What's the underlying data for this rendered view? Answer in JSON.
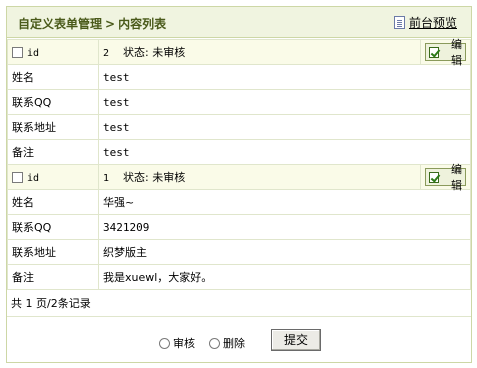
{
  "breadcrumb": {
    "root": "自定义表单管理",
    "separator": ">",
    "current": "内容列表"
  },
  "preview_link": "前台预览",
  "records": [
    {
      "id_label": "id",
      "id_value": "2",
      "status": "状态: 未审核",
      "edit_label": "编辑",
      "fields": [
        {
          "label": "姓名",
          "value": "test"
        },
        {
          "label": "联系QQ",
          "value": "test"
        },
        {
          "label": "联系地址",
          "value": "test"
        },
        {
          "label": "备注",
          "value": "test"
        }
      ]
    },
    {
      "id_label": "id",
      "id_value": "1",
      "status": "状态: 未审核",
      "edit_label": "编辑",
      "fields": [
        {
          "label": "姓名",
          "value": "华强~"
        },
        {
          "label": "联系QQ",
          "value": "3421209"
        },
        {
          "label": "联系地址",
          "value": "织梦版主"
        },
        {
          "label": "备注",
          "value": "我是xuewl，大家好。"
        }
      ]
    }
  ],
  "pagination": "共 1 页/2条记录",
  "actions": {
    "approve_label": "审核",
    "delete_label": "删除",
    "submit_label": "提交"
  }
}
